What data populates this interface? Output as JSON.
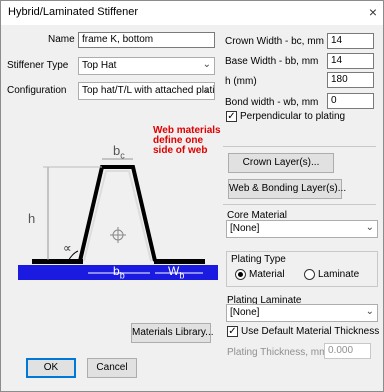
{
  "window": {
    "title": "Hybrid/Laminated Stiffener",
    "close_glyph": "×"
  },
  "form": {
    "name_label": "Name",
    "name_value": "frame K, bottom",
    "type_label": "Stiffener Type",
    "type_value": "Top Hat",
    "config_label": "Configuration",
    "config_value": "Top hat/T/L with attached plati"
  },
  "dims": {
    "crown_label": "Crown Width - bc, mm",
    "crown_value": "14",
    "base_label": "Base Width - bb, mm",
    "base_value": "14",
    "h_label": "h (mm)",
    "h_value": "180",
    "bond_label": "Bond width - wb, mm",
    "bond_value": "0",
    "perp_label": "Perpendicular to plating",
    "perp_checked": true
  },
  "diagram": {
    "note": "Web materials\ndefine one\nside of web",
    "bc": "b",
    "bc_sub": "c",
    "h": "h",
    "alpha": "∝",
    "bb": "b",
    "bb_sub": "b",
    "wb": "W",
    "wb_sub": "b"
  },
  "buttons": {
    "crown_layers": "Crown Layer(s)...",
    "web_bonding": "Web & Bonding Layer(s)...",
    "materials_library": "Materials Library...",
    "ok": "OK",
    "cancel": "Cancel"
  },
  "core": {
    "label": "Core Material",
    "value": "[None]"
  },
  "plating": {
    "type_label": "Plating Type",
    "opt_material": "Material",
    "opt_laminate": "Laminate",
    "selected": "Material",
    "laminate_label": "Plating Laminate",
    "laminate_value": "[None]",
    "use_default_label": "Use Default Material Thickness",
    "use_default_checked": true,
    "thickness_label": "Plating Thickness, mm",
    "thickness_value": "0.000"
  },
  "colors": {
    "accent_red": "#e00000",
    "plate_blue": "#1a1ae0",
    "web_black": "#000000"
  }
}
